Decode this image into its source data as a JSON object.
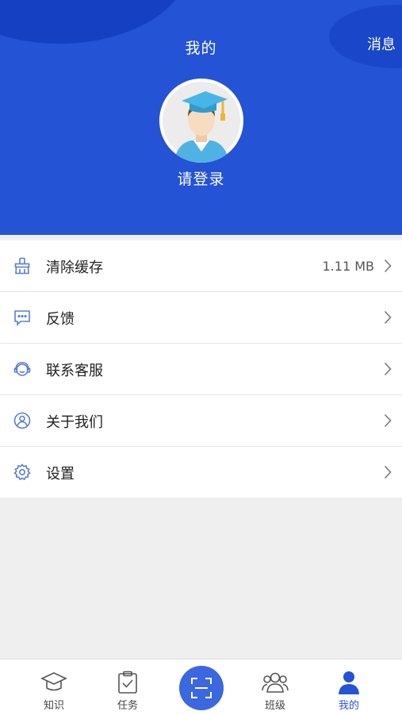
{
  "header": {
    "title": "我的",
    "messages_label": "消息",
    "login_label": "请登录"
  },
  "menu": {
    "items": [
      {
        "label": "清除缓存",
        "value": "1.11 MB",
        "icon": "broom-icon"
      },
      {
        "label": "反馈",
        "icon": "feedback-chat-icon"
      },
      {
        "label": "联系客服",
        "icon": "customer-service-icon"
      },
      {
        "label": "关于我们",
        "icon": "about-user-icon"
      },
      {
        "label": "设置",
        "icon": "gear-icon"
      }
    ]
  },
  "tabbar": {
    "tabs": [
      {
        "label": "知识",
        "icon": "graduation-cap-icon"
      },
      {
        "label": "任务",
        "icon": "clipboard-check-icon"
      },
      {
        "label": "",
        "icon": "scan-icon"
      },
      {
        "label": "班级",
        "icon": "group-icon"
      },
      {
        "label": "我的",
        "icon": "person-icon",
        "active": true
      }
    ]
  },
  "colors": {
    "header_bg": "#2453d6",
    "accent": "#2453d6",
    "icon_blue": "#5a7fd6",
    "page_bg": "#efefef"
  }
}
